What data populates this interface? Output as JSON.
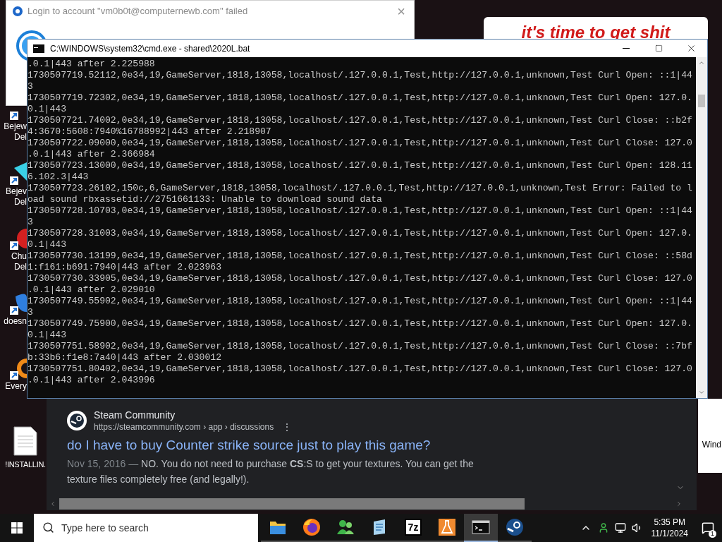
{
  "desktop_icons": [
    {
      "label_lines": [
        "Bejew",
        "Del"
      ]
    },
    {
      "label_lines": [
        "Bejev",
        "Del"
      ]
    },
    {
      "label_lines": [
        "Chu",
        "Del"
      ]
    },
    {
      "label_lines": [
        "doesn"
      ]
    },
    {
      "label_lines": [
        "Every"
      ]
    }
  ],
  "desktop_file": {
    "label": "!INSTALLIN."
  },
  "login_dialog": {
    "title": "Login to account \"vm0b0t@computernewb.com\" failed",
    "close": "×"
  },
  "banner": {
    "text": "it's time to get shit"
  },
  "console_window": {
    "title": "C:\\WINDOWS\\system32\\cmd.exe - shared\\2020L.bat",
    "lines": [
      ".0.1|443 after 2.225988",
      "1730507719.52112,0e34,19,GameServer,1818,13058,localhost/.127.0.0.1,Test,http://127.0.0.1,unknown,Test Curl Open: ::1|44",
      "3",
      "1730507719.72302,0e34,19,GameServer,1818,13058,localhost/.127.0.0.1,Test,http://127.0.0.1,unknown,Test Curl Open: 127.0.",
      "0.1|443",
      "1730507721.74002,0e34,19,GameServer,1818,13058,localhost/.127.0.0.1,Test,http://127.0.0.1,unknown,Test Curl Close: ::b2f",
      "4:3670:5608:7940%16788992|443 after 2.218907",
      "1730507722.09000,0e34,19,GameServer,1818,13058,localhost/.127.0.0.1,Test,http://127.0.0.1,unknown,Test Curl Close: 127.0",
      ".0.1|443 after 2.366984",
      "1730507723.13000,0e34,19,GameServer,1818,13058,localhost/.127.0.0.1,Test,http://127.0.0.1,unknown,Test Curl Open: 128.11",
      "6.102.3|443",
      "1730507723.26102,150c,6,GameServer,1818,13058,localhost/.127.0.0.1,Test,http://127.0.0.1,unknown,Test Error: Failed to l",
      "oad sound rbxassetid://2751661133: Unable to download sound data",
      "1730507728.10703,0e34,19,GameServer,1818,13058,localhost/.127.0.0.1,Test,http://127.0.0.1,unknown,Test Curl Open: ::1|44",
      "3",
      "1730507728.31003,0e34,19,GameServer,1818,13058,localhost/.127.0.0.1,Test,http://127.0.0.1,unknown,Test Curl Open: 127.0.",
      "0.1|443",
      "1730507730.13199,0e34,19,GameServer,1818,13058,localhost/.127.0.0.1,Test,http://127.0.0.1,unknown,Test Curl Close: ::58d",
      "1:f161:b691:7940|443 after 2.023963",
      "1730507730.33905,0e34,19,GameServer,1818,13058,localhost/.127.0.0.1,Test,http://127.0.0.1,unknown,Test Curl Close: 127.0",
      ".0.1|443 after 2.029010",
      "1730507749.55902,0e34,19,GameServer,1818,13058,localhost/.127.0.0.1,Test,http://127.0.0.1,unknown,Test Curl Open: ::1|44",
      "3",
      "1730507749.75900,0e34,19,GameServer,1818,13058,localhost/.127.0.0.1,Test,http://127.0.0.1,unknown,Test Curl Open: 127.0.",
      "0.1|443",
      "1730507751.58902,0e34,19,GameServer,1818,13058,localhost/.127.0.0.1,Test,http://127.0.0.1,unknown,Test Curl Close: ::7bf",
      "b:33b6:f1e8:7a40|443 after 2.030012",
      "1730507751.80402,0e34,19,GameServer,1818,13058,localhost/.127.0.0.1,Test,http://127.0.0.1,unknown,Test Curl Close: 127.0",
      ".0.1|443 after 2.043996"
    ]
  },
  "search_result": {
    "site_name": "Steam Community",
    "url": "https://steamcommunity.com › app › discussions",
    "more": "⋮",
    "title": "do I have to buy Counter strike source just to play this game?",
    "date": "Nov 15, 2016 —",
    "snippet": "NO. You do not need to purchase **CS**:S to get your textures. You can get the texture files completely free (and legally!)."
  },
  "side_window": {
    "text": "Wind"
  },
  "taskbar": {
    "search_placeholder": "Type here to search",
    "apps": [
      {
        "kind": "folder",
        "active": false
      },
      {
        "kind": "browser",
        "active": false
      },
      {
        "kind": "people",
        "active": false
      },
      {
        "kind": "notepad",
        "active": false
      },
      {
        "kind": "archiver",
        "label": "7z",
        "active": false
      },
      {
        "kind": "flask",
        "active": false
      },
      {
        "kind": "terminal",
        "active": true
      },
      {
        "kind": "steam",
        "active": false
      }
    ],
    "time": "5:35 PM",
    "date": "11/1/2024",
    "notifications": "1"
  }
}
